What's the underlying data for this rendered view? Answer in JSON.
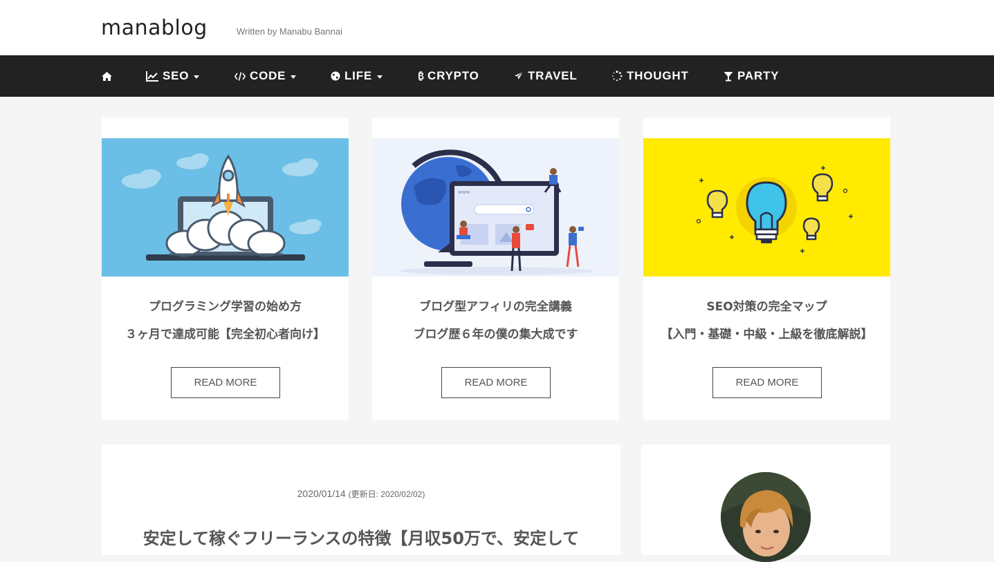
{
  "site": {
    "logo": "manablog",
    "tagline": "Written by Manabu Bannai"
  },
  "nav": {
    "items": [
      {
        "label": "",
        "icon": "home-icon",
        "dropdown": false
      },
      {
        "label": "SEO",
        "icon": "line-chart-icon",
        "dropdown": true
      },
      {
        "label": "CODE",
        "icon": "code-icon",
        "dropdown": true
      },
      {
        "label": "LIFE",
        "icon": "globe-icon",
        "dropdown": true
      },
      {
        "label": "CRYPTO",
        "icon": "bitcoin-icon",
        "dropdown": false
      },
      {
        "label": "TRAVEL",
        "icon": "plane-icon",
        "dropdown": false
      },
      {
        "label": "THOUGHT",
        "icon": "spinner-icon",
        "dropdown": false
      },
      {
        "label": "PARTY",
        "icon": "cocktail-icon",
        "dropdown": false
      }
    ]
  },
  "cards": [
    {
      "title_line1": "プログラミング学習の始め方",
      "title_line2": "３ヶ月で達成可能【完全初心者向け】",
      "button": "READ MORE",
      "image": "rocket-laptop-illustration",
      "bg": "#6bbfe6"
    },
    {
      "title_line1": "ブログ型アフィリの完全講義",
      "title_line2": "ブログ歴６年の僕の集大成です",
      "button": "READ MORE",
      "image": "globe-monitor-illustration",
      "bg": "#eef2fb"
    },
    {
      "title_line1": "SEO対策の完全マップ",
      "title_line2": "【入門・基礎・中級・上級を徹底解説】",
      "button": "READ MORE",
      "image": "lightbulbs-illustration",
      "bg": "#ffea00"
    }
  ],
  "post": {
    "date": "2020/01/14",
    "updated": "(更新日: 2020/02/02)",
    "title": "安定して稼ぐフリーランスの特徴【月収50万で、安定して"
  },
  "profile": {
    "avatar": "author-avatar"
  }
}
